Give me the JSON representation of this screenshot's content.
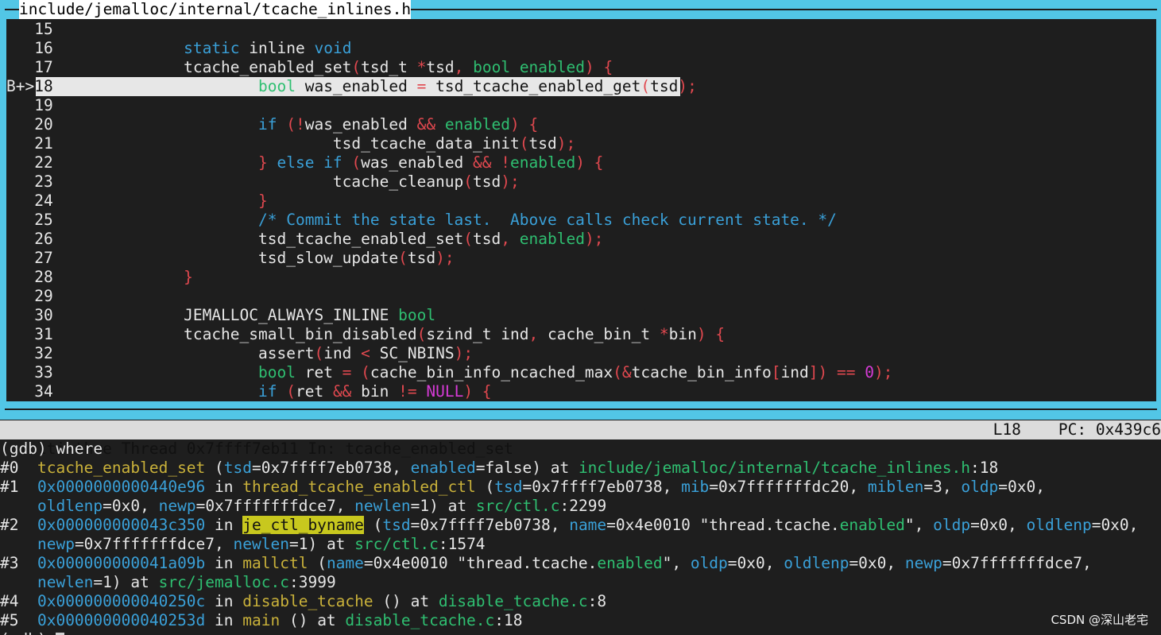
{
  "source_window": {
    "title": "include/jemalloc/internal/tcache_inlines.h",
    "breakpoint_marker": "B+>",
    "lines": [
      {
        "no": "15",
        "tokens": []
      },
      {
        "no": "16",
        "tokens": [
          [
            "kw",
            "static"
          ],
          [
            "plain",
            " inline "
          ],
          [
            "kw",
            "void"
          ]
        ]
      },
      {
        "no": "17",
        "tokens": [
          [
            "plain",
            "tcache_enabled_set"
          ],
          [
            "pu",
            "("
          ],
          [
            "plain",
            "tsd_t "
          ],
          [
            "pu",
            "*"
          ],
          [
            "plain",
            "tsd"
          ],
          [
            "pu",
            ", "
          ],
          [
            "ty",
            "bool"
          ],
          [
            "plain",
            " "
          ],
          [
            "ty",
            "enabled"
          ],
          [
            "pu",
            ") {"
          ]
        ]
      },
      {
        "no": "18",
        "tokens": [
          [
            "ty",
            "bool"
          ],
          [
            "plain",
            " was_enabled "
          ],
          [
            "pu",
            "="
          ],
          [
            "plain",
            " tsd_tcache_enabled_get"
          ],
          [
            "pu",
            "("
          ],
          [
            "plain",
            "tsd"
          ],
          [
            "pu",
            ");"
          ]
        ]
      },
      {
        "no": "19",
        "tokens": []
      },
      {
        "no": "20",
        "tokens": [
          [
            "kw",
            "if"
          ],
          [
            "pu",
            " (!"
          ],
          [
            "plain",
            "was_enabled "
          ],
          [
            "pu",
            "&&"
          ],
          [
            "plain",
            " "
          ],
          [
            "ty",
            "enabled"
          ],
          [
            "pu",
            ") {"
          ]
        ]
      },
      {
        "no": "21",
        "tokens": [
          [
            "plain",
            "tsd_tcache_data_init"
          ],
          [
            "pu",
            "("
          ],
          [
            "plain",
            "tsd"
          ],
          [
            "pu",
            ");"
          ]
        ]
      },
      {
        "no": "22",
        "tokens": [
          [
            "pu",
            "} "
          ],
          [
            "kw",
            "else if"
          ],
          [
            "pu",
            " ("
          ],
          [
            "plain",
            "was_enabled "
          ],
          [
            "pu",
            "&& !"
          ],
          [
            "ty",
            "enabled"
          ],
          [
            "pu",
            ") {"
          ]
        ]
      },
      {
        "no": "23",
        "tokens": [
          [
            "plain",
            "tcache_cleanup"
          ],
          [
            "pu",
            "("
          ],
          [
            "plain",
            "tsd"
          ],
          [
            "pu",
            ");"
          ]
        ]
      },
      {
        "no": "24",
        "tokens": [
          [
            "pu",
            "}"
          ]
        ]
      },
      {
        "no": "25",
        "tokens": [
          [
            "cm",
            "/* Commit the state last.  Above calls check current state. */"
          ]
        ]
      },
      {
        "no": "26",
        "tokens": [
          [
            "plain",
            "tsd_tcache_enabled_set"
          ],
          [
            "pu",
            "("
          ],
          [
            "plain",
            "tsd"
          ],
          [
            "pu",
            ", "
          ],
          [
            "ty",
            "enabled"
          ],
          [
            "pu",
            ");"
          ]
        ]
      },
      {
        "no": "27",
        "tokens": [
          [
            "plain",
            "tsd_slow_update"
          ],
          [
            "pu",
            "("
          ],
          [
            "plain",
            "tsd"
          ],
          [
            "pu",
            ");"
          ]
        ]
      },
      {
        "no": "28",
        "tokens": [
          [
            "pu",
            "}"
          ]
        ]
      },
      {
        "no": "29",
        "tokens": []
      },
      {
        "no": "30",
        "tokens": [
          [
            "plain",
            "JEMALLOC_ALWAYS_INLINE "
          ],
          [
            "ty",
            "bool"
          ]
        ]
      },
      {
        "no": "31",
        "tokens": [
          [
            "plain",
            "tcache_small_bin_disabled"
          ],
          [
            "pu",
            "("
          ],
          [
            "plain",
            "szind_t ind"
          ],
          [
            "pu",
            ", "
          ],
          [
            "plain",
            "cache_bin_t "
          ],
          [
            "pu",
            "*"
          ],
          [
            "plain",
            "bin"
          ],
          [
            "pu",
            ") {"
          ]
        ]
      },
      {
        "no": "32",
        "tokens": [
          [
            "plain",
            "assert"
          ],
          [
            "pu",
            "("
          ],
          [
            "plain",
            "ind "
          ],
          [
            "pu",
            "<"
          ],
          [
            "plain",
            " SC_NBINS"
          ],
          [
            "pu",
            ");"
          ]
        ]
      },
      {
        "no": "33",
        "tokens": [
          [
            "ty",
            "bool"
          ],
          [
            "plain",
            " ret "
          ],
          [
            "pu",
            "= ("
          ],
          [
            "plain",
            "cache_bin_info_ncached_max"
          ],
          [
            "pu",
            "(&"
          ],
          [
            "plain",
            "tcache_bin_info"
          ],
          [
            "pu",
            "["
          ],
          [
            "plain",
            "ind"
          ],
          [
            "pu",
            "]) == "
          ],
          [
            "num",
            "0"
          ],
          [
            "pu",
            ");"
          ]
        ]
      },
      {
        "no": "34",
        "tokens": [
          [
            "kw",
            "if"
          ],
          [
            "pu",
            " ("
          ],
          [
            "plain",
            "ret "
          ],
          [
            "pu",
            "&&"
          ],
          [
            "plain",
            " bin "
          ],
          [
            "pu",
            "!="
          ],
          [
            "plain",
            " "
          ],
          [
            "nul",
            "NULL"
          ],
          [
            "pu",
            ") {"
          ]
        ]
      }
    ]
  },
  "status_bar": {
    "left": "multi-thre Thread 0x7ffff7eb11 In: tcache_enabled_set",
    "line": "L18",
    "pc": "PC: 0x439c6"
  },
  "gdb": {
    "command_line": "(gdb) where",
    "lines": [
      [
        [
          "plain",
          "#0  "
        ],
        [
          "fn",
          "tcache_enabled_set"
        ],
        [
          "plain",
          " ("
        ],
        [
          "arg",
          "tsd"
        ],
        [
          "plain",
          "=0x7ffff7eb0738, "
        ],
        [
          "arg",
          "enabled"
        ],
        [
          "plain",
          "=false) at "
        ],
        [
          "file",
          "include/jemalloc/internal/tcache_inlines.h"
        ],
        [
          "plain",
          ":18"
        ]
      ],
      [
        [
          "plain",
          "#1  "
        ],
        [
          "addr",
          "0x0000000000440e96"
        ],
        [
          "plain",
          " in "
        ],
        [
          "fn",
          "thread_tcache_enabled_ctl"
        ],
        [
          "plain",
          " ("
        ],
        [
          "arg",
          "tsd"
        ],
        [
          "plain",
          "=0x7ffff7eb0738, "
        ],
        [
          "arg",
          "mib"
        ],
        [
          "plain",
          "=0x7fffffffdc20, "
        ],
        [
          "arg",
          "miblen"
        ],
        [
          "plain",
          "=3, "
        ],
        [
          "arg",
          "oldp"
        ],
        [
          "plain",
          "=0x0,"
        ]
      ],
      [
        [
          "plain",
          "    "
        ],
        [
          "arg",
          "oldlenp"
        ],
        [
          "plain",
          "=0x0, "
        ],
        [
          "arg",
          "newp"
        ],
        [
          "plain",
          "=0x7fffffffdce7, "
        ],
        [
          "arg",
          "newlen"
        ],
        [
          "plain",
          "=1) at "
        ],
        [
          "file",
          "src/ctl.c"
        ],
        [
          "plain",
          ":2299"
        ]
      ],
      [
        [
          "plain",
          "#2  "
        ],
        [
          "addr",
          "0x000000000043c350"
        ],
        [
          "plain",
          " in "
        ],
        [
          "hlfn",
          "je_ctl_byname"
        ],
        [
          "plain",
          " ("
        ],
        [
          "arg",
          "tsd"
        ],
        [
          "plain",
          "=0x7ffff7eb0738, "
        ],
        [
          "arg",
          "name"
        ],
        [
          "plain",
          "=0x4e0010 \"thread.tcache."
        ],
        [
          "strg",
          "enabled"
        ],
        [
          "plain",
          "\", "
        ],
        [
          "arg",
          "oldp"
        ],
        [
          "plain",
          "=0x0, "
        ],
        [
          "arg",
          "oldlenp"
        ],
        [
          "plain",
          "=0x0,"
        ]
      ],
      [
        [
          "plain",
          "    "
        ],
        [
          "arg",
          "newp"
        ],
        [
          "plain",
          "=0x7fffffffdce7, "
        ],
        [
          "arg",
          "newlen"
        ],
        [
          "plain",
          "=1) at "
        ],
        [
          "file",
          "src/ctl.c"
        ],
        [
          "plain",
          ":1574"
        ]
      ],
      [
        [
          "plain",
          "#3  "
        ],
        [
          "addr",
          "0x000000000041a09b"
        ],
        [
          "plain",
          " in "
        ],
        [
          "fn",
          "mallctl"
        ],
        [
          "plain",
          " ("
        ],
        [
          "arg",
          "name"
        ],
        [
          "plain",
          "=0x4e0010 \"thread.tcache."
        ],
        [
          "strg",
          "enabled"
        ],
        [
          "plain",
          "\", "
        ],
        [
          "arg",
          "oldp"
        ],
        [
          "plain",
          "=0x0, "
        ],
        [
          "arg",
          "oldlenp"
        ],
        [
          "plain",
          "=0x0, "
        ],
        [
          "arg",
          "newp"
        ],
        [
          "plain",
          "=0x7fffffffdce7,"
        ]
      ],
      [
        [
          "plain",
          "    "
        ],
        [
          "arg",
          "newlen"
        ],
        [
          "plain",
          "=1) at "
        ],
        [
          "file",
          "src/jemalloc.c"
        ],
        [
          "plain",
          ":3999"
        ]
      ],
      [
        [
          "plain",
          "#4  "
        ],
        [
          "addr",
          "0x000000000040250c"
        ],
        [
          "plain",
          " in "
        ],
        [
          "fn",
          "disable_tcache"
        ],
        [
          "plain",
          " () at "
        ],
        [
          "file",
          "disable_tcache.c"
        ],
        [
          "plain",
          ":8"
        ]
      ],
      [
        [
          "plain",
          "#5  "
        ],
        [
          "addr",
          "0x000000000040253d"
        ],
        [
          "plain",
          " in "
        ],
        [
          "fn",
          "main"
        ],
        [
          "plain",
          " () at "
        ],
        [
          "file",
          "disable_tcache.c"
        ],
        [
          "plain",
          ":18"
        ]
      ]
    ],
    "prompt": "(gdb) "
  },
  "watermark": "CSDN @深山老宅",
  "colors": {
    "frame": "#52c6e6",
    "keyword": "#3aa0d8",
    "type": "#2fbf71",
    "punct": "#e0484f",
    "function": "#c9b13a",
    "highlight": "#c8c81e"
  }
}
